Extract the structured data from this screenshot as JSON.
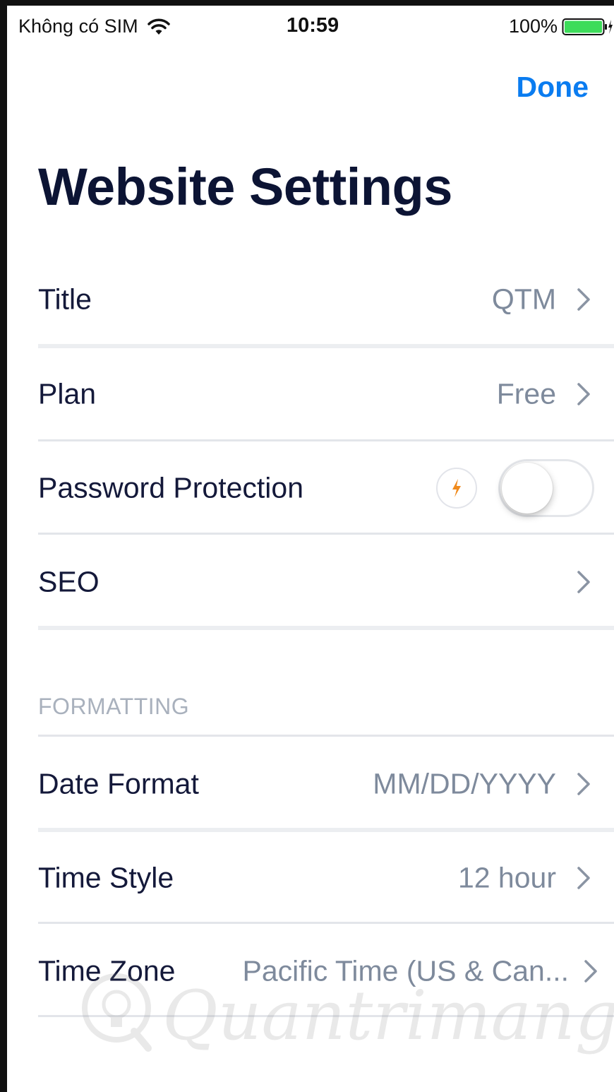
{
  "status_bar": {
    "carrier": "Không có SIM",
    "time": "10:59",
    "battery_percent": "100%",
    "battery_level": 1.0,
    "charging": true
  },
  "header": {
    "done_label": "Done",
    "title": "Website Settings"
  },
  "rows": {
    "title": {
      "label": "Title",
      "value": "QTM"
    },
    "plan": {
      "label": "Plan",
      "value": "Free"
    },
    "password_protection": {
      "label": "Password Protection",
      "enabled": false
    },
    "seo": {
      "label": "SEO"
    }
  },
  "formatting": {
    "header": "FORMATTING",
    "date_format": {
      "label": "Date Format",
      "value": "MM/DD/YYYY"
    },
    "time_style": {
      "label": "Time Style",
      "value": "12 hour"
    },
    "time_zone": {
      "label": "Time Zone",
      "value": "Pacific Time (US & Can..."
    }
  },
  "watermark": "Quantrimang",
  "colors": {
    "accent": "#0a7cf0",
    "title_text": "#0c1434",
    "value_text": "#7e8a9c",
    "section_header": "#a9b1bd",
    "bolt": "#f08a1c",
    "battery": "#3ddc5a"
  },
  "icons": {
    "wifi": "wifi-icon",
    "battery": "battery-icon",
    "charging": "bolt-icon",
    "chevron": "chevron-right-icon",
    "upgrade": "bolt-icon"
  }
}
